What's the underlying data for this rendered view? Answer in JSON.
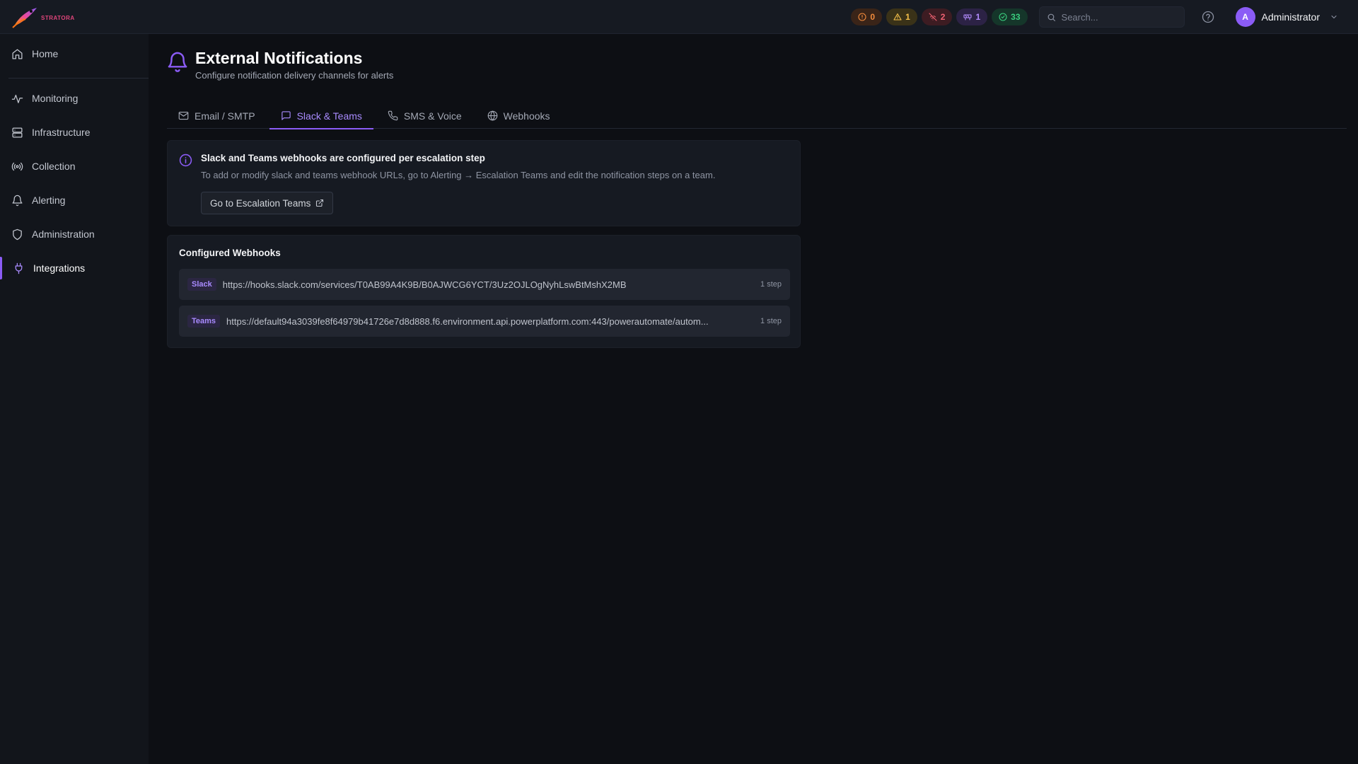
{
  "brand": {
    "name": "STRATORA"
  },
  "header": {
    "status_pills": [
      {
        "kind": "critical",
        "count": "0",
        "icon": "alert-circle-icon",
        "color": "#f38b3c"
      },
      {
        "kind": "warning",
        "count": "1",
        "icon": "alert-triangle-icon",
        "color": "#f5c04a"
      },
      {
        "kind": "offline",
        "count": "2",
        "icon": "wifi-off-icon",
        "color": "#f06272"
      },
      {
        "kind": "maintenance",
        "count": "1",
        "icon": "construction-icon",
        "color": "#b48cff"
      },
      {
        "kind": "ok",
        "count": "33",
        "icon": "check-circle-icon",
        "color": "#3ad07f"
      }
    ],
    "search": {
      "placeholder": "Search...",
      "value": ""
    },
    "user": {
      "initial": "A",
      "name": "Administrator"
    }
  },
  "sidebar": {
    "items": [
      {
        "label": "Home",
        "icon": "home-icon",
        "active": false
      },
      {
        "label": "Monitoring",
        "icon": "activity-icon",
        "active": false
      },
      {
        "label": "Infrastructure",
        "icon": "server-icon",
        "active": false
      },
      {
        "label": "Collection",
        "icon": "radio-icon",
        "active": false
      },
      {
        "label": "Alerting",
        "icon": "bell-icon",
        "active": false
      },
      {
        "label": "Administration",
        "icon": "shield-icon",
        "active": false
      },
      {
        "label": "Integrations",
        "icon": "plug-icon",
        "active": true
      }
    ]
  },
  "page": {
    "title": "External Notifications",
    "subtitle": "Configure notification delivery channels for alerts",
    "accent": "#8b5cf6"
  },
  "tabs": [
    {
      "label": "Email / SMTP",
      "icon": "mail-icon",
      "active": false
    },
    {
      "label": "Slack & Teams",
      "icon": "message-square-icon",
      "active": true
    },
    {
      "label": "SMS & Voice",
      "icon": "phone-icon",
      "active": false
    },
    {
      "label": "Webhooks",
      "icon": "globe-icon",
      "active": false
    }
  ],
  "info_card": {
    "title": "Slack and Teams webhooks are configured per escalation step",
    "text": "To add or modify slack and teams webhook URLs, go to Alerting → Escalation Teams and edit the notification steps on a team.",
    "button_label": "Go to Escalation Teams"
  },
  "webhooks_card": {
    "title": "Configured Webhooks",
    "rows": [
      {
        "type": "Slack",
        "url": "https://hooks.slack.com/services/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",
        "steps": "1 step"
      },
      {
        "type": "Teams",
        "url": "https://default94a3039fe8f64979b41726e7d8d888.f6.environment.api.powerplatform.com:443/powerautomate/autom...",
        "steps": "1 step"
      }
    ]
  }
}
